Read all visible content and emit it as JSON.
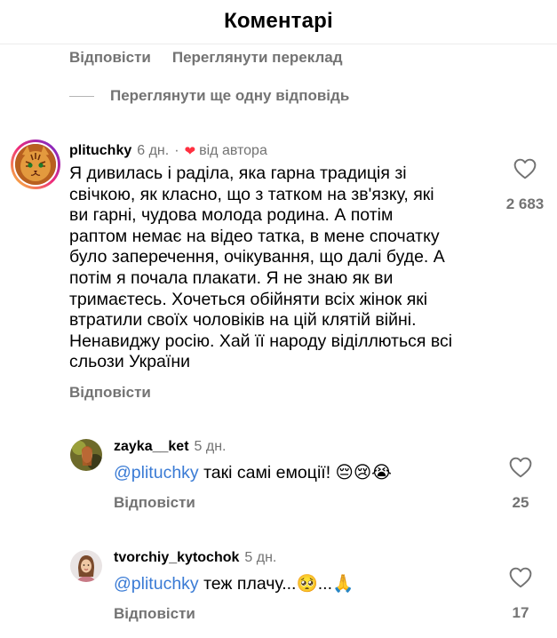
{
  "header": {
    "title": "Коментарі"
  },
  "top_actions": {
    "reply": "Відповісти",
    "translate": "Переглянути переклад"
  },
  "more_replies": "Переглянути ще одну відповідь",
  "comment": {
    "username": "plituchky",
    "time": "6 дн.",
    "separator": "·",
    "author_badge": "від автора",
    "lines": [
      "Я дивилась і раділа, яка гарна традиція зі",
      "свічкою, як класно, що з татком на зв'язку, які",
      "ви гарні, чудова молода родина. А потім",
      "раптом немає на відео татка, в мене спочатку",
      "було заперечення, очікування, що далі буде. А",
      "потім я почала плакати. Я не знаю як ви",
      "тримаєтесь. Хочеться обійняти всіх жінок які",
      "втратили своїх чоловіків на цій клятій війні.",
      "Ненавиджу росію. Хай її народу віділлються всі",
      "сльози України"
    ],
    "like_count": "2 683",
    "reply_label": "Відповісти",
    "like_icon": "heart-outline-icon"
  },
  "replies": [
    {
      "username": "zayka__ket",
      "time": "5 дн.",
      "mention": "@plituchky",
      "text": " такі самі емоції! 😔😢😭",
      "like_count": "25",
      "reply_label": "Відповісти"
    },
    {
      "username": "tvorchiy_kytochok",
      "time": "5 дн.",
      "mention": "@plituchky",
      "text": " теж плачу...🥺...🙏",
      "like_count": "17",
      "reply_label": "Відповісти"
    }
  ]
}
